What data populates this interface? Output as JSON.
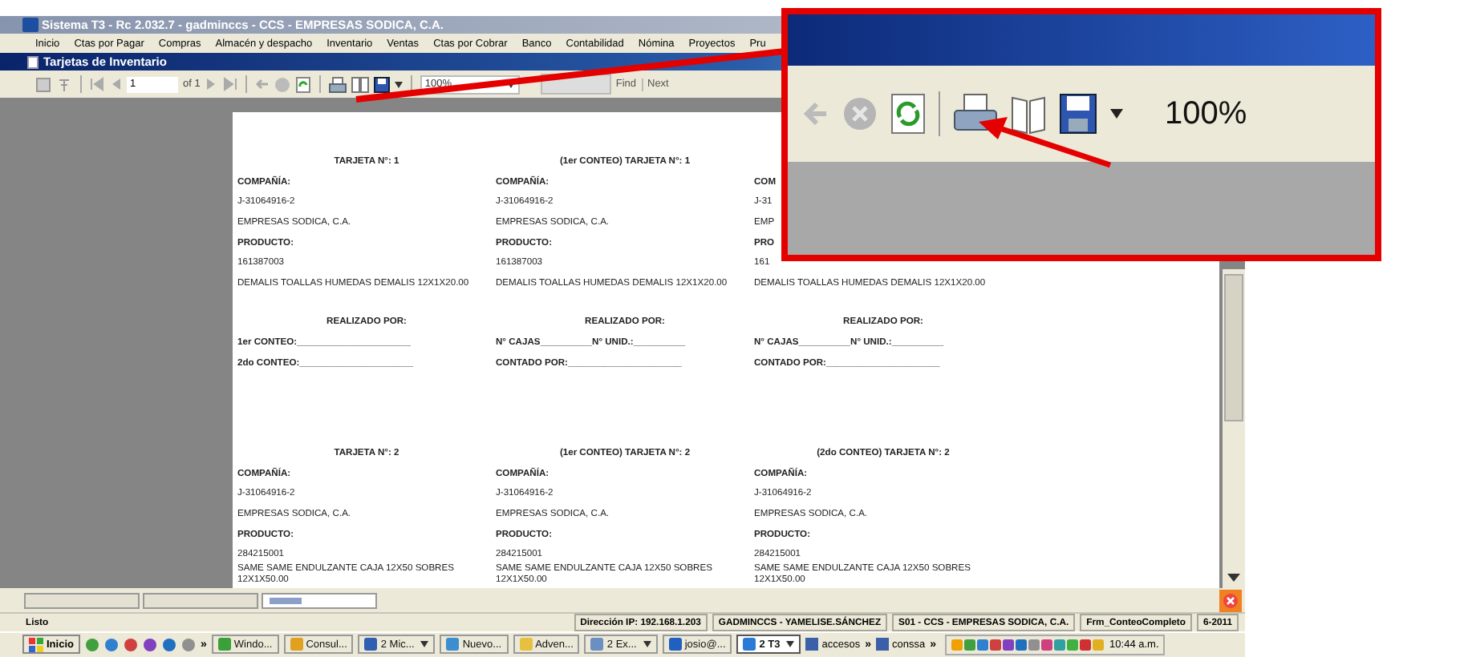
{
  "window": {
    "title": "Sistema T3 - Rc 2.032.7 - gadminccs - CCS - EMPRESAS SODICA, C.A."
  },
  "menu": [
    "Inicio",
    "Ctas por Pagar",
    "Compras",
    "Almacén y despacho",
    "Inventario",
    "Ventas",
    "Ctas por Cobrar",
    "Banco",
    "Contabilidad",
    "Nómina",
    "Proyectos",
    "Pru"
  ],
  "document": {
    "title": "Tarjetas de Inventario"
  },
  "toolbar": {
    "page": "1",
    "page_count": "of 1",
    "zoom": "100%",
    "find": "Find",
    "next": "Next"
  },
  "card_rows": [
    {
      "cards": [
        {
          "title": "TARJETA N°: 1",
          "company_label": "COMPAÑÍA:",
          "rif": "J-31064916-2",
          "company": "EMPRESAS SODICA, C.A.",
          "product_label": "PRODUCTO:",
          "code": "161387003",
          "description": "DEMALIS TOALLAS HUMEDAS DEMALIS 12X1X20.00",
          "done_by": "REALIZADO POR:",
          "lines": [
            "1er CONTEO:______________________",
            "2do CONTEO:______________________"
          ]
        },
        {
          "title": "(1er CONTEO) TARJETA N°: 1",
          "company_label": "COMPAÑÍA:",
          "rif": "J-31064916-2",
          "company": "EMPRESAS SODICA, C.A.",
          "product_label": "PRODUCTO:",
          "code": "161387003",
          "description": "DEMALIS TOALLAS HUMEDAS DEMALIS 12X1X20.00",
          "done_by": "REALIZADO POR:",
          "lines": [
            "N° CAJAS__________N° UNID.:__________",
            "CONTADO POR:______________________"
          ]
        },
        {
          "company_label": "COM",
          "rif": "J-31",
          "company": "EMP",
          "product_label": "PRO",
          "code": "161",
          "description": "DEMALIS TOALLAS HUMEDAS DEMALIS 12X1X20.00",
          "done_by": "REALIZADO POR:",
          "lines": [
            "N° CAJAS__________N° UNID.:__________",
            "CONTADO POR:______________________"
          ]
        }
      ]
    },
    {
      "cards": [
        {
          "title": "TARJETA N°: 2",
          "company_label": "COMPAÑÍA:",
          "rif": "J-31064916-2",
          "company": "EMPRESAS SODICA, C.A.",
          "product_label": "PRODUCTO:",
          "code": "284215001",
          "description": "SAME SAME ENDULZANTE CAJA 12X50 SOBRES 12X1X50.00"
        },
        {
          "title": "(1er CONTEO) TARJETA N°: 2",
          "company_label": "COMPAÑÍA:",
          "rif": "J-31064916-2",
          "company": "EMPRESAS SODICA, C.A.",
          "product_label": "PRODUCTO:",
          "code": "284215001",
          "description": "SAME SAME ENDULZANTE CAJA 12X50 SOBRES 12X1X50.00"
        },
        {
          "title": "(2do CONTEO) TARJETA N°: 2",
          "company_label": "COMPAÑÍA:",
          "rif": "J-31064916-2",
          "company": "EMPRESAS SODICA, C.A.",
          "product_label": "PRODUCTO:",
          "code": "284215001",
          "description": "SAME SAME ENDULZANTE CAJA 12X50 SOBRES 12X1X50.00"
        }
      ]
    }
  ],
  "report_tabs": [
    {
      "selected": false
    },
    {
      "selected": false
    },
    {
      "selected": true
    }
  ],
  "callout": {
    "zoom": "100%"
  },
  "status_bar": {
    "status": "Listo",
    "panels": [
      "Dirección IP: 192.168.1.203",
      "GADMINCCS - YAMELISE.SÁNCHEZ",
      "S01 - CCS - EMPRESAS SODICA, C.A.",
      "Frm_ConteoCompleto",
      "6-2011"
    ]
  },
  "taskbar": {
    "start": "Inicio",
    "items": [
      {
        "kind": "chevron",
        "label": "»"
      },
      {
        "kind": "button",
        "label": "Windo...",
        "grouped": false,
        "selected": false
      },
      {
        "kind": "button",
        "label": "Consul...",
        "grouped": false,
        "selected": false
      },
      {
        "kind": "button",
        "label": "2 Mic...",
        "grouped": true,
        "selected": false
      },
      {
        "kind": "button",
        "label": "Nuevo...",
        "grouped": false,
        "selected": false
      },
      {
        "kind": "button",
        "label": "Adven...",
        "grouped": false,
        "selected": false
      },
      {
        "kind": "button",
        "label": "2 Ex...",
        "grouped": true,
        "selected": false
      },
      {
        "kind": "button",
        "label": "josio@...",
        "grouped": false,
        "selected": false
      },
      {
        "kind": "button",
        "label": "2 T3",
        "grouped": true,
        "selected": true
      },
      {
        "kind": "toolbar",
        "label": "accesos"
      },
      {
        "kind": "chevron",
        "label": "»"
      },
      {
        "kind": "toolbar",
        "label": "conssa"
      },
      {
        "kind": "chevron",
        "label": "»"
      }
    ],
    "clock": "10:44 a.m."
  }
}
